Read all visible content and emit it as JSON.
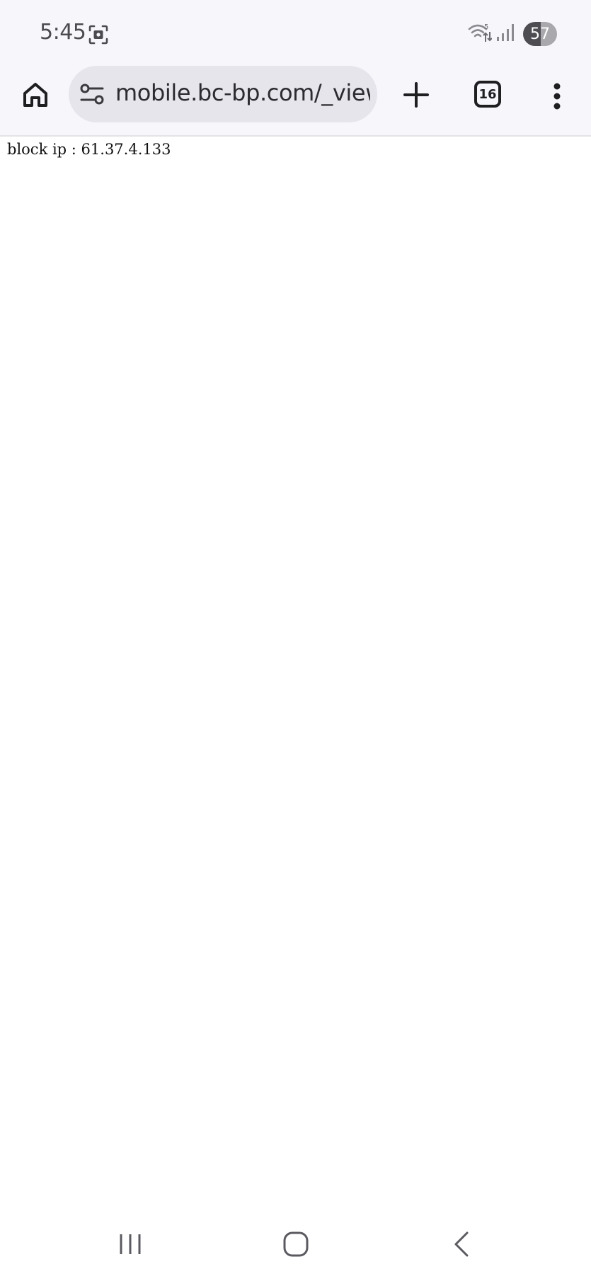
{
  "status_bar": {
    "time": "5:45",
    "battery_level": "57",
    "icons": [
      "screenshot-icon",
      "wifi-icon",
      "signal-icon",
      "battery-icon"
    ]
  },
  "toolbar": {
    "url": "mobile.bc-bp.com/_view",
    "tab_count": "16",
    "icons": [
      "home-icon",
      "site-settings-icon",
      "plus-icon",
      "tab-switcher-icon",
      "more-vert-icon"
    ]
  },
  "page": {
    "message": "block ip : 61.37.4.133"
  },
  "nav_bar": {
    "icons": [
      "recent-apps-icon",
      "home-nav-icon",
      "back-icon"
    ]
  },
  "colors": {
    "chrome_bg": "#f7f6fb",
    "omnibox_bg": "#e6e5ec",
    "icon_dark": "#1f1f22",
    "status_text": "#4a4a4f"
  }
}
